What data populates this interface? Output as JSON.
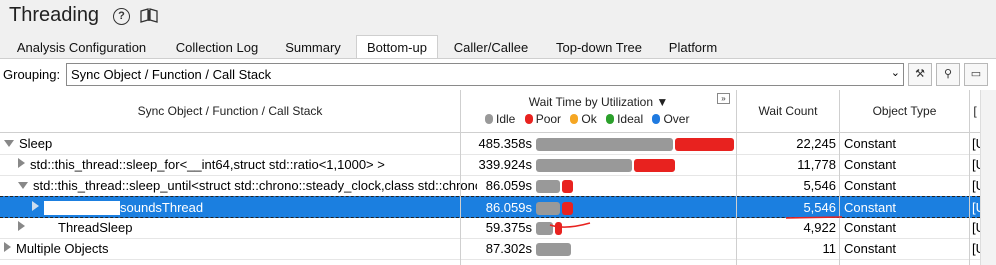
{
  "window": {
    "title": "Threading",
    "help_icon": "?"
  },
  "tabs": [
    "Analysis Configuration",
    "Collection Log",
    "Summary",
    "Bottom-up",
    "Caller/Callee",
    "Top-down Tree",
    "Platform"
  ],
  "active_tab": "Bottom-up",
  "grouping": {
    "label": "Grouping:",
    "value": "Sync Object / Function / Call Stack"
  },
  "columns": {
    "name": "Sync Object / Function / Call Stack",
    "wait_time": "Wait Time by Utilization ▼",
    "wait_count": "Wait Count",
    "object_type": "Object Type",
    "extra": "["
  },
  "legend": [
    {
      "label": "Idle",
      "color": "#999999"
    },
    {
      "label": "Poor",
      "color": "#e8221f"
    },
    {
      "label": "Ok",
      "color": "#f5a623"
    },
    {
      "label": "Ideal",
      "color": "#2ba02b"
    },
    {
      "label": "Over",
      "color": "#1f7ae0"
    }
  ],
  "rows": [
    {
      "name": "Sleep",
      "wait_time": "485.358s",
      "idle": 0.7,
      "poor": 0.3,
      "wait_count": "22,245",
      "object_type": "Constant",
      "extra": "[U"
    },
    {
      "name": "std::this_thread::sleep_for<__int64,struct std::ratio<1,1000> >",
      "wait_time": "339.924s",
      "idle": 0.7,
      "poor": 0.3,
      "wait_count": "11,778",
      "object_type": "Constant",
      "extra": "[U"
    },
    {
      "name": "std::this_thread::sleep_until<struct std::chrono::steady_clock,class std::chrono::",
      "wait_time": "86.059s",
      "idle": 0.68,
      "poor": 0.32,
      "wait_count": "5,546",
      "object_type": "Constant",
      "extra": "[U"
    },
    {
      "name": "soundsThread",
      "wait_time": "86.059s",
      "idle": 0.68,
      "poor": 0.32,
      "wait_count": "5,546",
      "object_type": "Constant",
      "extra": "[U"
    },
    {
      "name": "ThreadSleep",
      "wait_time": "59.375s",
      "idle": 0.72,
      "poor": 0.28,
      "wait_count": "4,922",
      "object_type": "Constant",
      "extra": "[U"
    },
    {
      "name": "Multiple Objects",
      "wait_time": "87.302s",
      "idle": 1.0,
      "poor": 0.0,
      "wait_count": "11",
      "object_type": "Constant",
      "extra": "[U"
    }
  ]
}
